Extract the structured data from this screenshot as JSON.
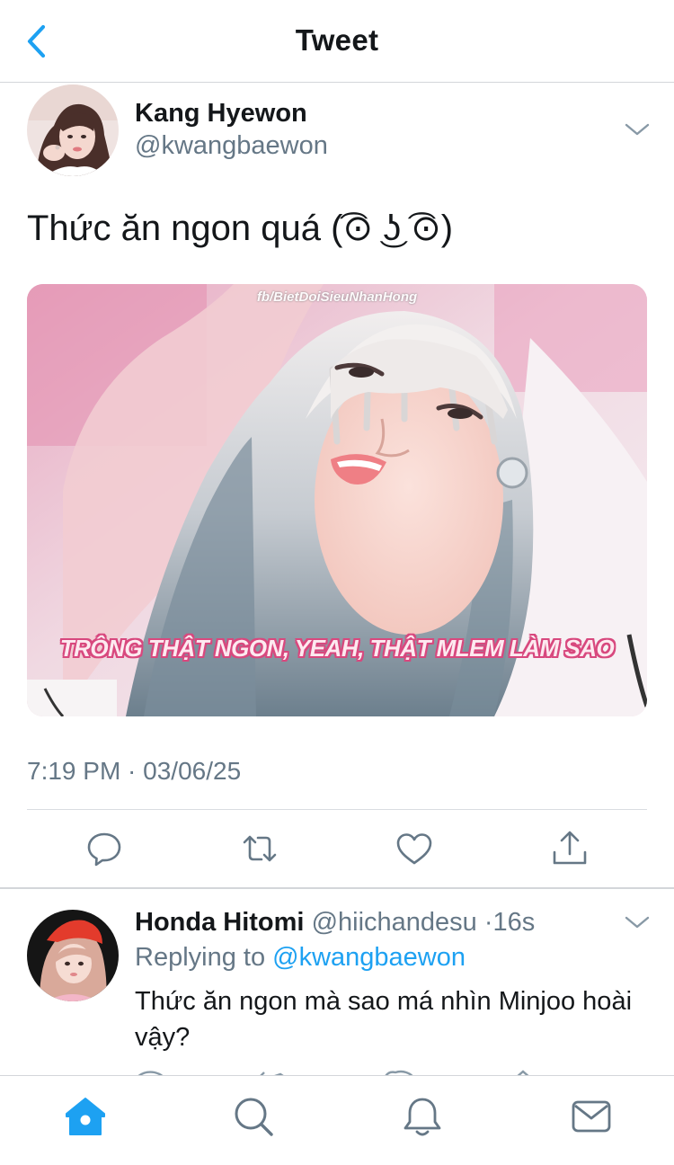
{
  "header": {
    "title": "Tweet"
  },
  "tweet": {
    "author_name": "Kang Hyewon",
    "author_handle": "@kwangbaewon",
    "text": "Thức ăn ngon quá (͡⊙ ͜ʖ ͡⊙)",
    "media": {
      "watermark": "fb/BietDoiSieuNhanHong",
      "caption": "TRÔNG THẬT NGON, YEAH, THẬT MLEM LÀM SAO"
    },
    "timestamp": "7:19 PM · 03/06/25"
  },
  "actions": [
    "reply-icon",
    "retweet-icon",
    "like-icon",
    "share-icon"
  ],
  "reply": {
    "author_name": "Honda Hitomi",
    "author_handle": "@hiichandesu",
    "separator": "·",
    "time": "16s",
    "replying_prefix": "Replying to ",
    "replying_to": "@kwangbaewon",
    "text": "Thức ăn ngon mà sao má nhìn Minjoo hoài vậy?"
  },
  "tabbar": {
    "tabs": [
      "home-icon",
      "search-icon",
      "notifications-icon",
      "messages-icon"
    ],
    "active_color": "#1da1f2",
    "inactive_color": "#657786"
  },
  "colors": {
    "accent": "#1da1f2",
    "secondary_text": "#657786"
  }
}
